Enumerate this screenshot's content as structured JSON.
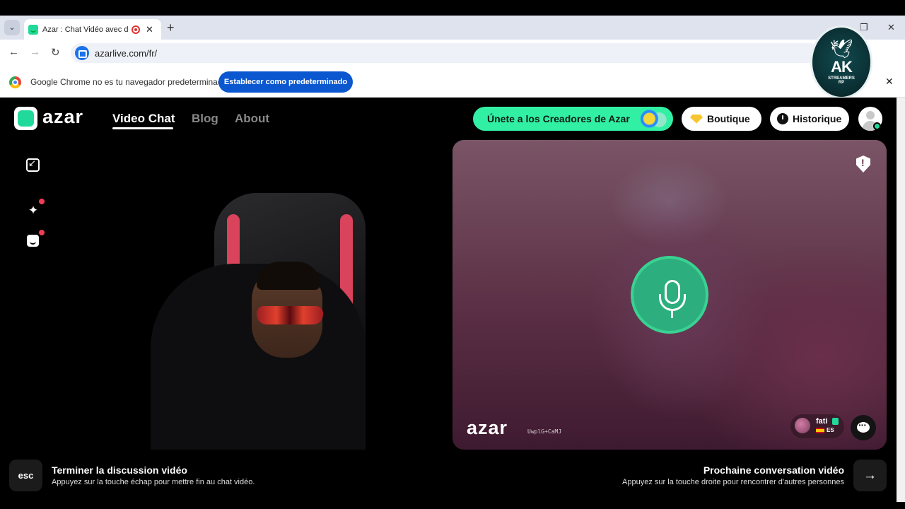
{
  "browser": {
    "tab_title": "Azar : Chat Vidéo avec de nouveaux amis",
    "tab_close": "✕",
    "new_tab": "+",
    "url": "azarlive.com/fr/",
    "back": "←",
    "forward": "→",
    "reload": "↻",
    "win_restore": "❐",
    "win_close": "✕",
    "tab_list": "⌄"
  },
  "infobar": {
    "message": "Google Chrome no es tu navegador predeterminado",
    "button": "Establecer como predeterminado",
    "close": "✕"
  },
  "overlay_badge": {
    "text": "AK",
    "subtitle": "STREAMERS",
    "subtitle2": "RP",
    "bird": "🕊"
  },
  "header": {
    "logo": "azar",
    "nav": [
      "Video Chat",
      "Blog",
      "About"
    ],
    "creators_button": "Únete a los Creadores de Azar",
    "boutique_button": "Boutique",
    "historique_button": "Historique"
  },
  "left_panel": {
    "sparkle": "✦"
  },
  "right_panel": {
    "watermark": "azar",
    "watermark_id": "UwplG+CaMJ",
    "user_name": "fati",
    "user_lang": "ES"
  },
  "footer": {
    "esc_key": "esc",
    "end_title": "Terminer la discussion vidéo",
    "end_sub": "Appuyez sur la touche échap pour mettre fin au chat vidéo.",
    "next_title": "Prochaine conversation vidéo",
    "next_sub": "Appuyez sur la touche droite pour rencontrer d'autres personnes",
    "next_key": "→"
  },
  "colors": {
    "brand_green": "#21d99a",
    "creators_green": "#31f0a4",
    "mic_green": "#2dae7e",
    "chrome_blue": "#0b57d0"
  }
}
